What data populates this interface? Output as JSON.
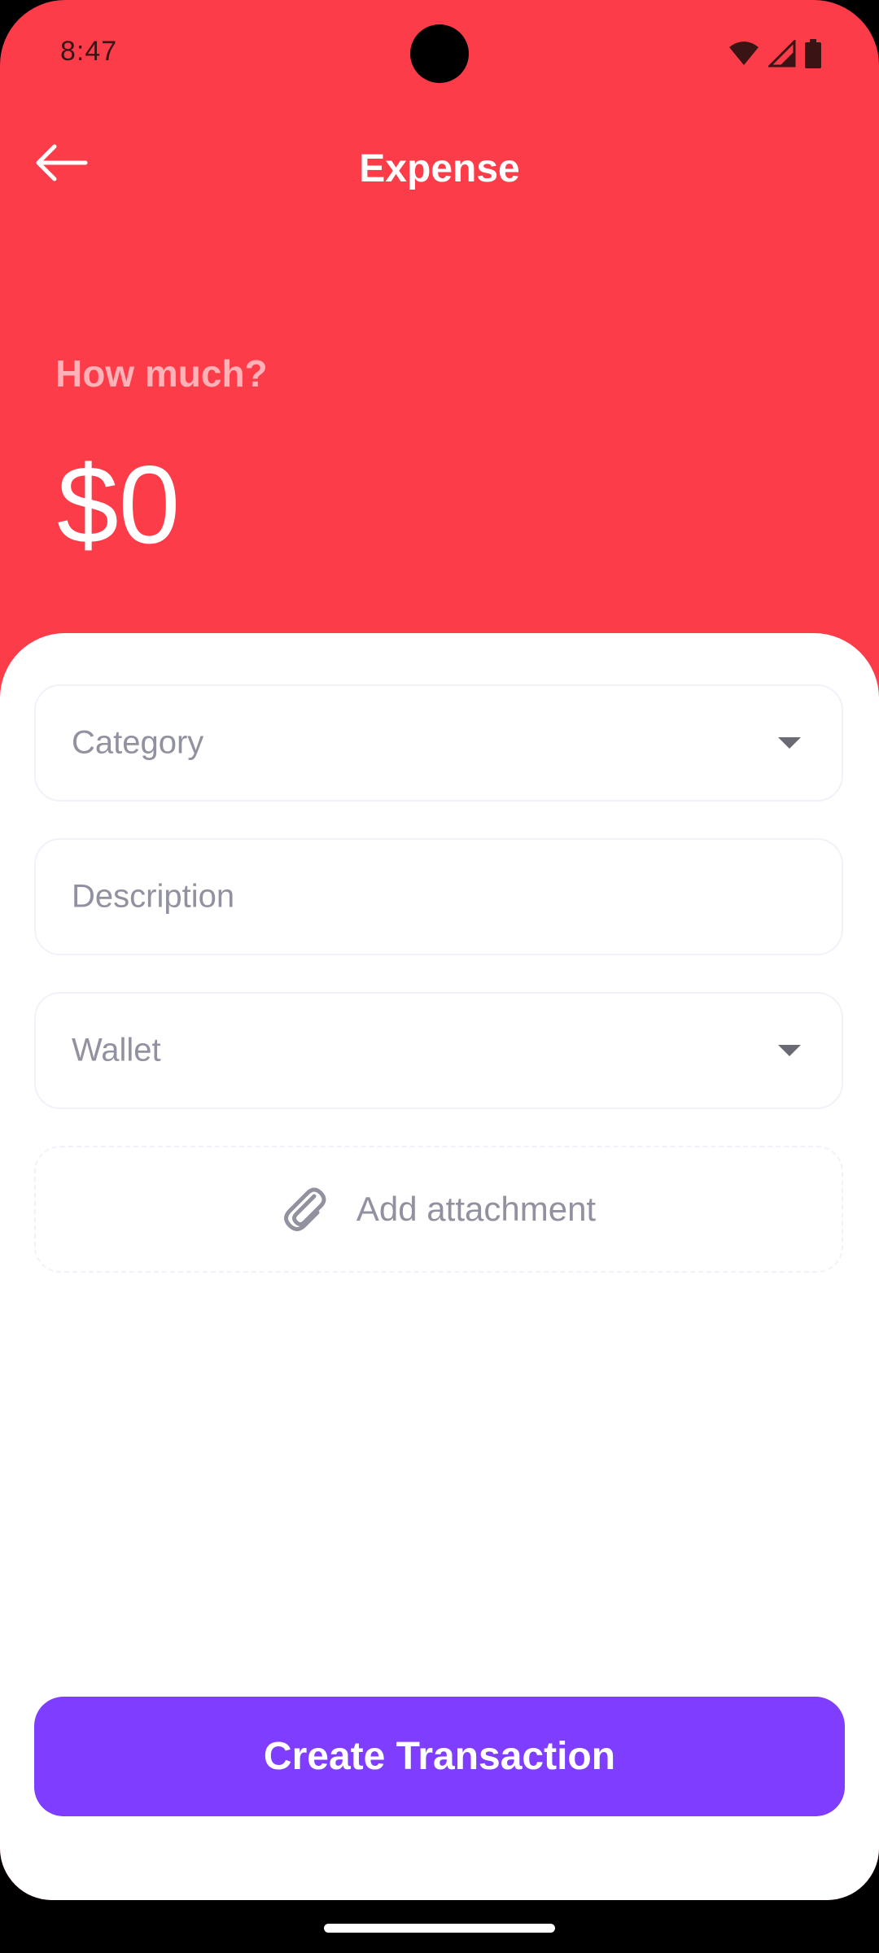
{
  "status_bar": {
    "time": "8:47",
    "icons": [
      "wifi-icon",
      "cellular-signal-icon",
      "battery-icon"
    ]
  },
  "app_bar": {
    "title": "Expense",
    "back_icon": "arrow-left-icon"
  },
  "amount": {
    "label": "How much?",
    "value": "$0"
  },
  "form": {
    "category": {
      "placeholder": "Category",
      "icon": "caret-down-icon"
    },
    "description": {
      "placeholder": "Description"
    },
    "wallet": {
      "placeholder": "Wallet",
      "icon": "caret-down-icon"
    },
    "attachment": {
      "label": "Add attachment",
      "icon": "paperclip-icon"
    }
  },
  "actions": {
    "create_label": "Create Transaction"
  },
  "colors": {
    "header_background": "#FD3C4A",
    "primary": "#7F3DFF",
    "field_border": "#F1F1FA",
    "placeholder_text": "#91919F",
    "surface": "#FFFFFF"
  }
}
